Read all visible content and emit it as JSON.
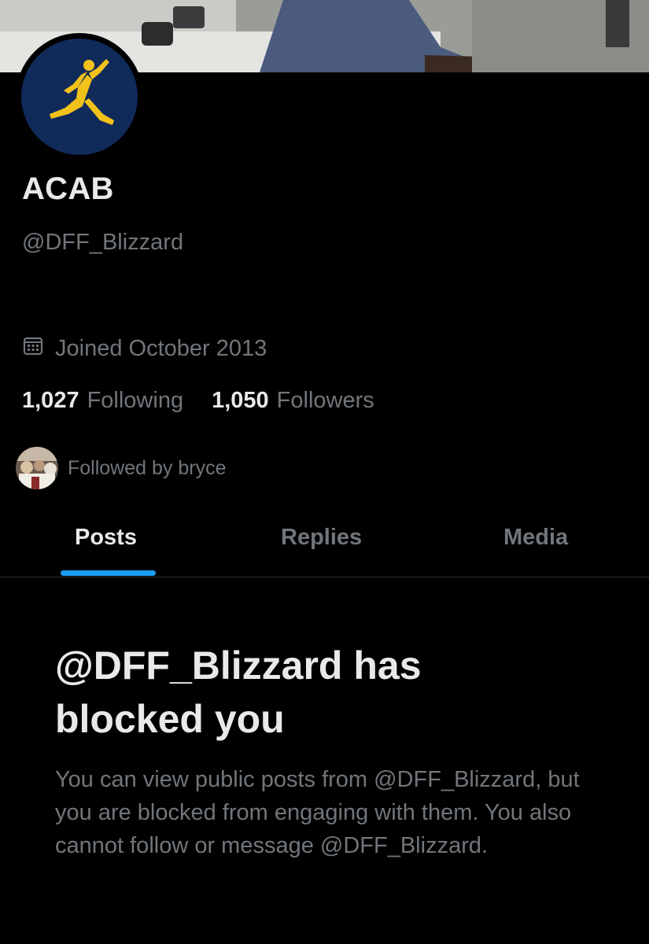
{
  "profile": {
    "display_name": "ACAB",
    "handle": "@DFF_Blizzard",
    "joined": "Joined October 2013",
    "following_count": "1,027",
    "following_label": "Following",
    "followers_count": "1,050",
    "followers_label": "Followers",
    "followed_by": "Followed by bryce"
  },
  "tabs": [
    {
      "label": "Posts",
      "active": true
    },
    {
      "label": "Replies",
      "active": false
    },
    {
      "label": "Media",
      "active": false
    }
  ],
  "blocked": {
    "title_line1": "@DFF_Blizzard has",
    "title_line2": "blocked you",
    "body": "You can view public posts from @DFF_Blizzard, but you are blocked from engaging with them. You also cannot follow or message @DFF_Blizzard."
  },
  "icons": {
    "joined": "calendar-icon",
    "avatar_logo": "jumpman-logo"
  },
  "colors": {
    "background": "#000000",
    "primary_text": "#e7e9ea",
    "secondary_text": "#71767b",
    "accent": "#1d9bf0",
    "avatar_bg": "#102a5a",
    "logo": "#f2c21b"
  }
}
